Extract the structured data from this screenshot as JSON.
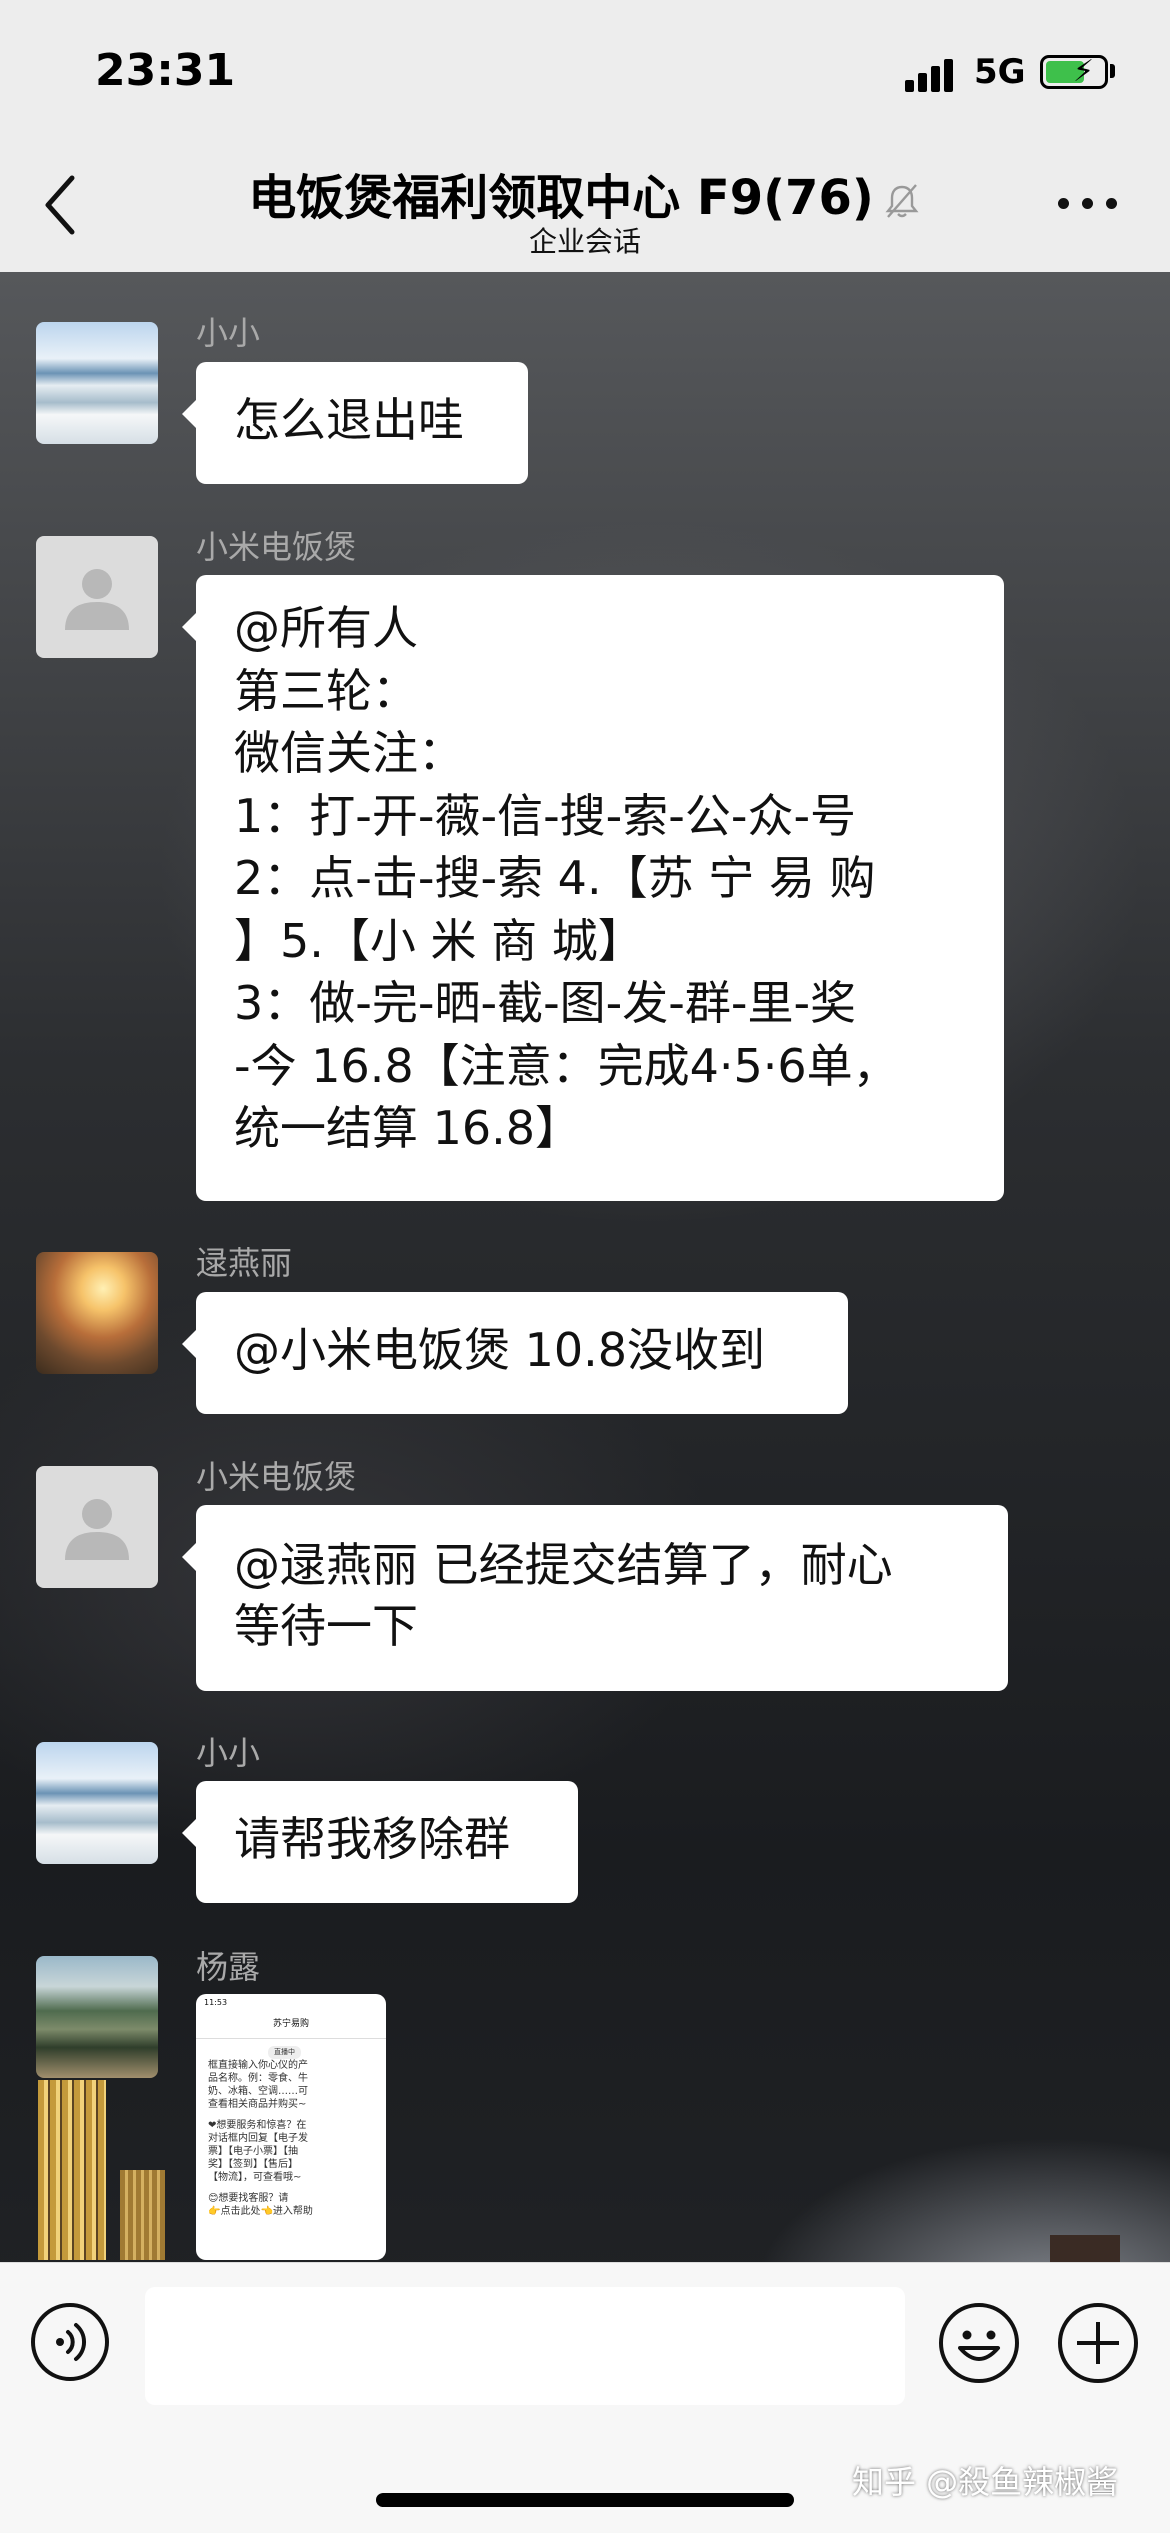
{
  "status_bar": {
    "time": "23:31",
    "network": "5G"
  },
  "header": {
    "title": "电饭煲福利领取中心 F9(76)",
    "subtitle": "企业会话"
  },
  "messages": [
    {
      "sender": "小小",
      "avatar": "snow-landscape-avatar",
      "lines": [
        "怎么退出哇"
      ]
    },
    {
      "sender": "小米电饭煲",
      "avatar": "default-avatar",
      "lines": [
        "@所有人",
        "第三轮：",
        "微信关注：",
        "1：打-开-薇-信-搜-索-公-众-号",
        "2：点-击-搜-索 4.【苏 宁 易 购",
        "】5.【小 米 商 城】",
        "3：做-完-晒-截-图-发-群-里-奖",
        "-今 16.8【注意：完成4·5·6单，",
        "统一结算 16.8】"
      ]
    },
    {
      "sender": "逯燕丽",
      "avatar": "sunset-girl-avatar",
      "lines": [
        "@小米电饭煲 10.8没收到"
      ]
    },
    {
      "sender": "小米电饭煲",
      "avatar": "default-avatar",
      "lines": [
        "@逯燕丽 已经提交结算了，耐心",
        "等待一下"
      ]
    },
    {
      "sender": "小小",
      "avatar": "snow-landscape-avatar",
      "lines": [
        "请帮我移除群"
      ]
    },
    {
      "sender": "杨露",
      "avatar": "lake-portrait-avatar",
      "image": {
        "time": "11:53",
        "title": "苏宁易购",
        "pill": "直播中",
        "lines": [
          "框直接输入你心仪的产",
          "品名称。例：零食、牛",
          "奶、冰箱、空调……可",
          "查看相关商品并购买~",
          "",
          "❤想要服务和惊喜？在",
          "对话框内回复【电子发",
          "票】【电子小票】【抽",
          "奖】【签到】【售后】",
          "【物流】，可查看哦~",
          "",
          "😊想要找客服？请",
          "👉点击此处👈进入帮助"
        ]
      }
    }
  ],
  "watermark": "知乎 @殺鱼辣椒酱",
  "colors": {
    "bubble": "#ffffff",
    "topbar": "#ededed",
    "name_text": "#a9a9a9",
    "battery_fill": "#3ec04b"
  }
}
